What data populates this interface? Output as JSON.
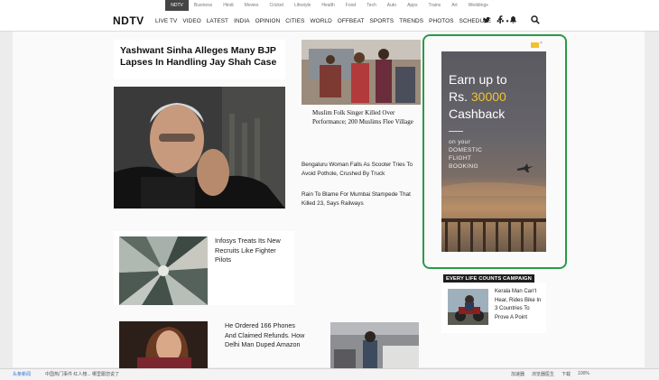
{
  "network_bar": {
    "items": [
      "NDTV",
      "Business",
      "Hindi",
      "Movies",
      "Cricket",
      "Lifestyle",
      "Health",
      "Food",
      "Tech",
      "Auto",
      "Apps",
      "Trains",
      "Art",
      "Weddings"
    ],
    "active_index": 0
  },
  "header": {
    "logo": "NDTV",
    "nav": [
      "LIVE TV",
      "VIDEO",
      "LATEST",
      "INDIA",
      "OPINION",
      "CITIES",
      "WORLD",
      "OFFBEAT",
      "SPORTS",
      "TRENDS",
      "PHOTOS",
      "SCHEDULE"
    ],
    "more": "• • •",
    "social": [
      "twitter-icon",
      "facebook-icon",
      "notification-icon"
    ],
    "search_icon": "search-icon"
  },
  "lead_story": {
    "headline": "Yashwant Sinha Alleges Many BJP Lapses In Handling Jay Shah Case"
  },
  "side_stories": [
    {
      "title": "Muslim Folk Singer Killed Over Performance; 200 Muslims Flee Village"
    },
    {
      "title": "Bengaluru Woman Falls As Scooter Tries To Avoid Pothole, Crushed By Truck"
    },
    {
      "title": "Rain To Blame For Mumbai Stampede That Killed 23, Says Railways"
    }
  ],
  "ad": {
    "line1": "Earn up to",
    "line2_prefix": "Rs. ",
    "line2_amount": "30000",
    "line3": "Cashback",
    "sub1": "on your",
    "sub2": "DOMESTIC",
    "sub3": "FLIGHT",
    "sub4": "BOOKING",
    "highlight_color": "#f0c431",
    "frame_color": "#2a9a45"
  },
  "campaign": {
    "label": "EVERY LIFE COUNTS CAMPAIGN",
    "story": "Kerala Man Can't Hear, Rides Bike In 3 Countries To Prove A Point"
  },
  "lower_stories": [
    {
      "title": "Infosys Treats Its New Recruits Like Fighter Pilots"
    },
    {
      "title": "He Ordered 166 Phones And Claimed Refunds. How Delhi Man Duped Amazon"
    }
  ],
  "status_bar": {
    "left_a": "头条新闻",
    "left_b": "中国热门事件 红人榜...  哪里跟您说了",
    "right": [
      "加速器",
      "浏览器医生",
      "下载",
      "100%"
    ]
  }
}
